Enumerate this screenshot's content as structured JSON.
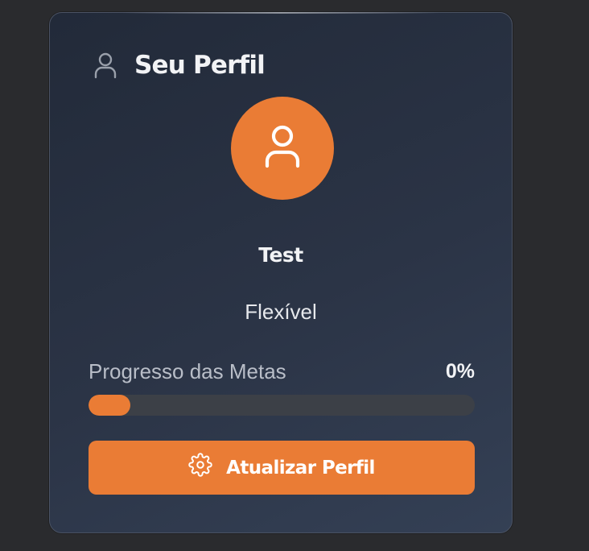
{
  "profile_card": {
    "title": "Seu Perfil",
    "title_icon": "user-icon",
    "avatar_icon": "user-icon",
    "user_name": "Test",
    "plan": "Flexível",
    "progress": {
      "label": "Progresso das Metas",
      "value_text": "0%",
      "value": 0
    },
    "update_button": {
      "label": "Atualizar Perfil",
      "icon": "gear-icon"
    }
  },
  "colors": {
    "accent": "#ea7c35",
    "card_background": "#2b3446",
    "page_background": "#2a2b2e",
    "track": "#3c4047"
  }
}
